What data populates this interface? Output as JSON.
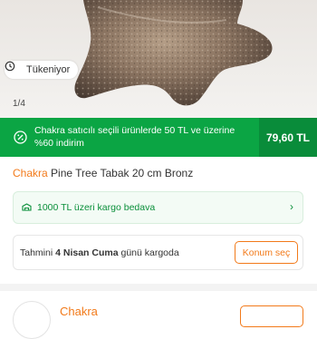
{
  "gallery": {
    "stock_badge": "Tükeniyor",
    "pager": "1/4"
  },
  "promo": {
    "text": "Chakra satıcılı seçili ürünlerde 50 TL ve üzerine %60 indirim",
    "price": "79,60 TL",
    "colors": {
      "background": "#0ba544",
      "price_background": "#098c3a"
    }
  },
  "product": {
    "brand": "Chakra",
    "name": "Pine Tree Tabak 20 cm Bronz",
    "brand_color": "#f27a1a"
  },
  "shipping": {
    "text": "1000 TL üzeri kargo bedava",
    "icon": "truck-icon"
  },
  "delivery": {
    "prefix": "Tahmini",
    "date": "4 Nisan Cuma",
    "suffix": "günü kargoda",
    "button": "Konum seç"
  },
  "seller": {
    "name": "Chakra"
  }
}
